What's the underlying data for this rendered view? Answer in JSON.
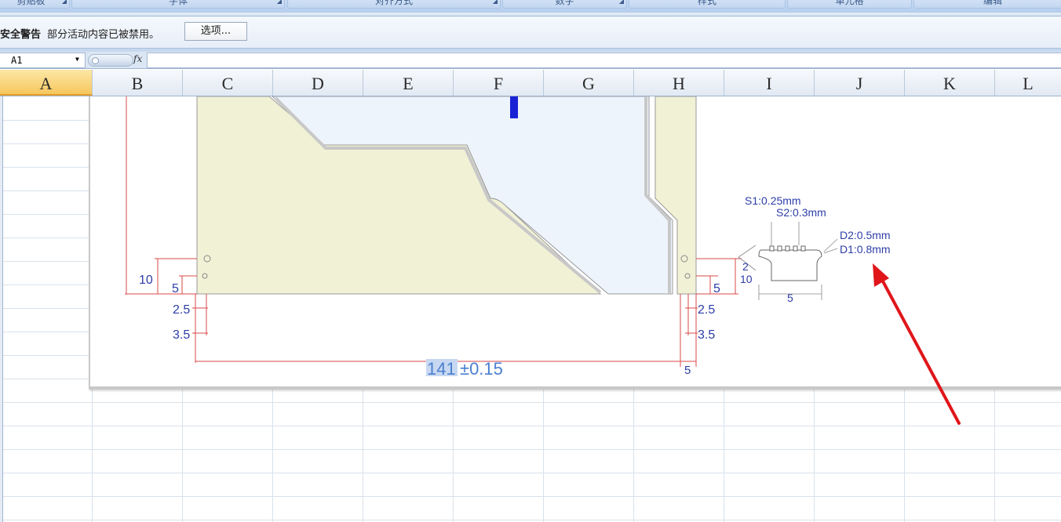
{
  "ribbon": {
    "groups": [
      "剪贴板",
      "字体",
      "对齐方式",
      "数字",
      "样式",
      "单元格",
      "编辑"
    ]
  },
  "message_bar": {
    "title": "安全警告",
    "text": "部分活动内容已被禁用。",
    "options_button": "选项..."
  },
  "formula_bar": {
    "name_box": "A1",
    "fx_label": "fx",
    "formula": ""
  },
  "columns": [
    "A",
    "B",
    "C",
    "D",
    "E",
    "F",
    "G",
    "H",
    "I",
    "J",
    "K",
    "L"
  ],
  "selected_column": "A",
  "drawing": {
    "dimensions": {
      "left_10": "10",
      "left_5": "5",
      "left_2_5": "2.5",
      "left_3_5": "3.5",
      "right_5_top": "5",
      "right_2_5": "2.5",
      "right_3_5": "3.5",
      "width_prefix": "141",
      "width_tolerance": "±0.15",
      "right_5_bottom": "5"
    },
    "detail": {
      "s1": "S1:0.25mm",
      "s2": "S2:0.3mm",
      "d2": "D2:0.5mm",
      "d1": "D1:0.8mm",
      "h2": "2",
      "h10": "10",
      "w5": "5"
    },
    "colors": {
      "panel_fill": "#f1f1d6",
      "channel_fill": "#edf4fc",
      "dim_line": "#d94a4a",
      "dim_text": "#2d3ea8",
      "marker": "#1a22d6",
      "arrow": "#e0161b"
    }
  }
}
